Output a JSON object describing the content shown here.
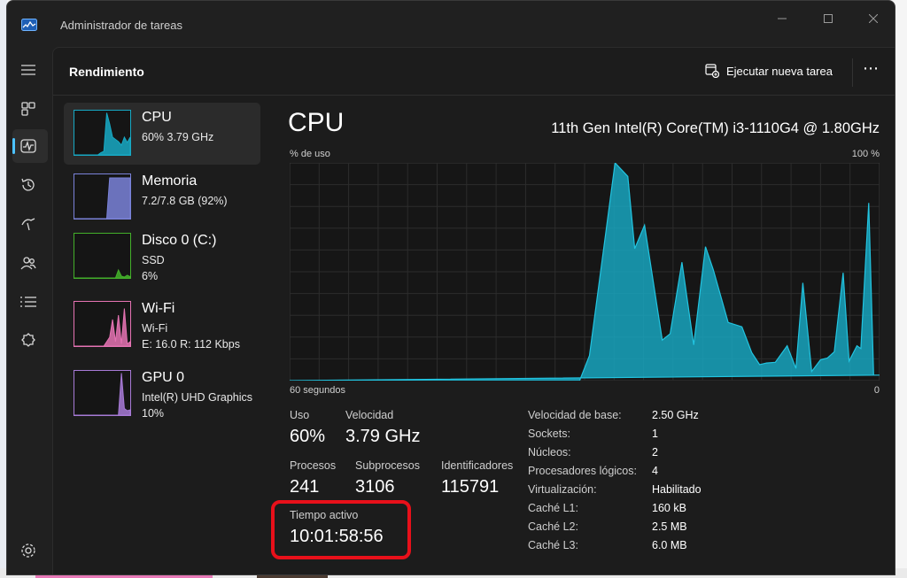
{
  "window": {
    "title": "Administrador de tareas"
  },
  "header": {
    "title": "Rendimiento",
    "run_task_label": "Ejecutar nueva tarea",
    "more_label": "⋯"
  },
  "nav": [
    "menu-icon",
    "processes-icon",
    "performance-icon",
    "app-history-icon",
    "startup-apps-icon",
    "users-icon",
    "details-icon",
    "services-icon",
    "settings-icon"
  ],
  "devices": [
    {
      "name": "CPU",
      "line1": "60%  3.79 GHz",
      "line2": "",
      "color": "#17a9c4",
      "values": [
        0,
        0,
        0,
        0,
        0,
        0,
        0,
        0,
        0,
        5,
        8,
        95,
        70,
        40,
        35,
        30,
        22,
        40,
        28,
        40
      ]
    },
    {
      "name": "Memoria",
      "line1": "7.2/7.8 GB (92%)",
      "line2": "",
      "color": "#7a82d9",
      "values": [
        0,
        0,
        0,
        0,
        0,
        0,
        0,
        0,
        0,
        0,
        0,
        0,
        92,
        92,
        92,
        92,
        92,
        92,
        92,
        92
      ]
    },
    {
      "name": "Disco 0 (C:)",
      "line1": "SSD",
      "line2": "6%",
      "color": "#43b02a",
      "values": [
        0,
        0,
        0,
        0,
        0,
        0,
        0,
        0,
        0,
        0,
        0,
        0,
        0,
        0,
        0,
        18,
        4,
        2,
        6,
        3
      ]
    },
    {
      "name": "Wi-Fi",
      "line1": "Wi-Fi",
      "line2": "E: 16.0  R: 112 Kbps",
      "color": "#e573b3",
      "values": [
        0,
        0,
        0,
        0,
        0,
        0,
        0,
        0,
        0,
        0,
        0,
        10,
        20,
        60,
        10,
        70,
        5,
        85,
        5,
        10
      ]
    },
    {
      "name": "GPU 0",
      "line1": "Intel(R) UHD Graphics",
      "line2": "10%",
      "color": "#a77ad6",
      "values": [
        0,
        0,
        0,
        0,
        0,
        0,
        0,
        0,
        0,
        0,
        0,
        0,
        0,
        0,
        0,
        0,
        95,
        15,
        10,
        12
      ]
    }
  ],
  "cpu": {
    "title": "CPU",
    "model": "11th Gen Intel(R) Core(TM) i3-1110G4 @ 1.80GHz",
    "y_label": "% de uso",
    "y_max_label": "100 %",
    "x_left_label": "60 segundos",
    "x_right_label": "0",
    "stats": {
      "uso_label": "Uso",
      "uso": "60%",
      "velocidad_label": "Velocidad",
      "velocidad": "3.79 GHz",
      "procesos_label": "Procesos",
      "procesos": "241",
      "subprocesos_label": "Subprocesos",
      "subprocesos": "3106",
      "identificadores_label": "Identificadores",
      "identificadores": "115791",
      "tiempo_label": "Tiempo activo",
      "tiempo": "10:01:58:56"
    },
    "specs": [
      {
        "label": "Velocidad de base:",
        "value": "2.50 GHz"
      },
      {
        "label": "Sockets:",
        "value": "1"
      },
      {
        "label": "Núcleos:",
        "value": "2"
      },
      {
        "label": "Procesadores lógicos:",
        "value": "4"
      },
      {
        "label": "Virtualización:",
        "value": "Habilitado"
      },
      {
        "label": "Caché L1:",
        "value": "160 kB"
      },
      {
        "label": "Caché L2:",
        "value": "2.5 MB"
      },
      {
        "label": "Caché L3:",
        "value": "6.0 MB"
      }
    ]
  },
  "chart_data": {
    "type": "area",
    "title": "CPU",
    "ylabel": "% de uso",
    "xlabel": "60 segundos",
    "ylim": [
      0,
      100
    ],
    "xlim": [
      60,
      0
    ],
    "grid": true,
    "color": "#17a9c4",
    "x": [
      60,
      30.5,
      29.5,
      26.9,
      25.6,
      24.9,
      23.9,
      22.1,
      21.3,
      20.1,
      18.9,
      17.7,
      16.9,
      15.4,
      14.0,
      13.0,
      12.2,
      11.5,
      10.6,
      9.4,
      8.5,
      7.8,
      6.9,
      6.0,
      5.3,
      4.6,
      3.7,
      3.1,
      2.3,
      1.9,
      1.1,
      0.6,
      0,
      60
    ],
    "y": [
      0,
      0,
      11.5,
      100,
      93.8,
      60.6,
      71.4,
      18.6,
      21.5,
      54.4,
      16.4,
      61.5,
      50.8,
      26.7,
      24.7,
      12.9,
      7.3,
      8.1,
      8.4,
      16.0,
      5.6,
      44.9,
      4.2,
      9.6,
      10.4,
      13.2,
      49.5,
      9.0,
      16.0,
      14.7,
      81.6,
      2.5,
      2.5,
      0
    ]
  }
}
